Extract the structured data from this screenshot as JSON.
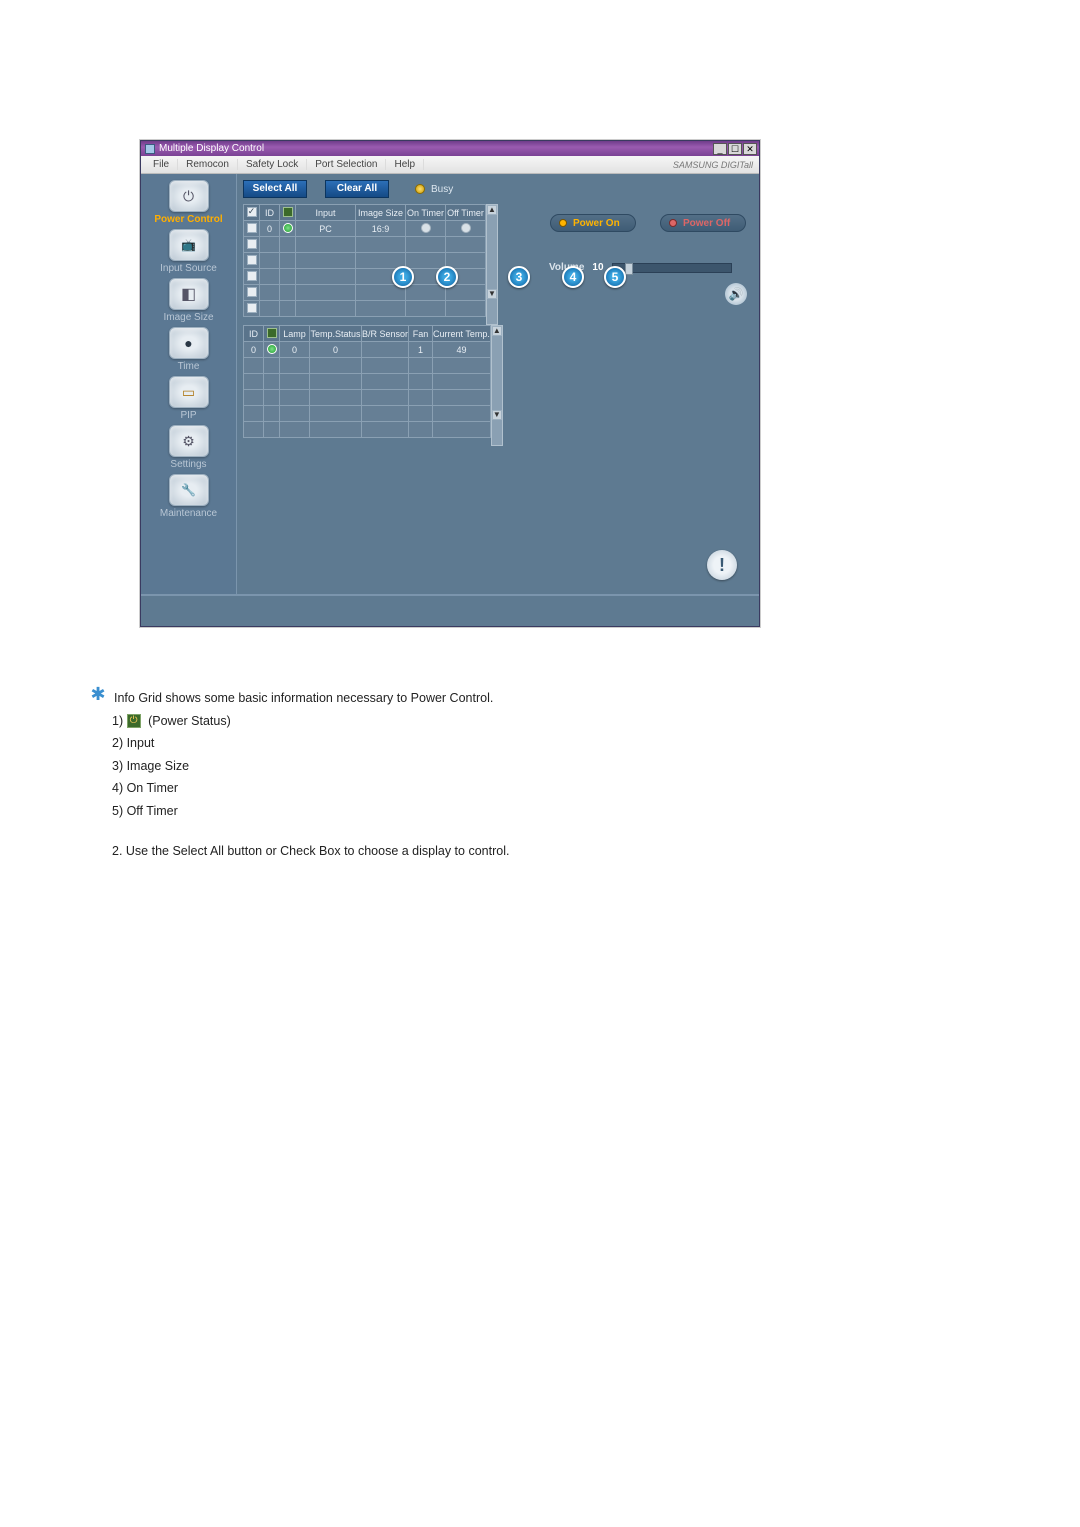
{
  "window": {
    "title": "Multiple Display Control",
    "menu": [
      "File",
      "Remocon",
      "Safety Lock",
      "Port Selection",
      "Help"
    ],
    "brand": "SAMSUNG DIGITall"
  },
  "sidebar": {
    "items": [
      {
        "label": "Power Control"
      },
      {
        "label": "Input Source"
      },
      {
        "label": "Image Size"
      },
      {
        "label": "Time"
      },
      {
        "label": "PIP"
      },
      {
        "label": "Settings"
      },
      {
        "label": "Maintenance"
      }
    ]
  },
  "toolbar": {
    "select_all": "Select All",
    "clear_all": "Clear All",
    "busy": "Busy"
  },
  "grid1": {
    "headers": {
      "id": "ID",
      "psicon": "",
      "input": "Input",
      "image": "Image Size",
      "on": "On Timer",
      "off": "Off Timer"
    },
    "row0": {
      "id": "0",
      "input": "PC",
      "image": "16:9"
    }
  },
  "grid2": {
    "headers": {
      "id": "ID",
      "psicon": "",
      "lamp": "Lamp",
      "temp": "Temp.Status",
      "br": "B/R Sensor",
      "fan": "Fan",
      "ctemp": "Current Temp."
    },
    "row0": {
      "id": "0",
      "lamp": "0",
      "temp": "0",
      "fan": "1",
      "ctemp": "49"
    }
  },
  "callouts": [
    "1",
    "2",
    "3",
    "4",
    "5"
  ],
  "panel": {
    "power_on": "Power On",
    "power_off": "Power Off",
    "volume_label": "Volume",
    "volume_value": "10"
  },
  "description": {
    "intro": "Info Grid shows some basic information necessary to Power Control.",
    "list": {
      "l1_prefix": "1)",
      "l1_text": "(Power Status)",
      "l2": "2) Input",
      "l3": "3) Image Size",
      "l4": "4) On Timer",
      "l5": "5) Off Timer"
    },
    "line2": "2.  Use the Select All button or Check Box to choose a display to control."
  }
}
